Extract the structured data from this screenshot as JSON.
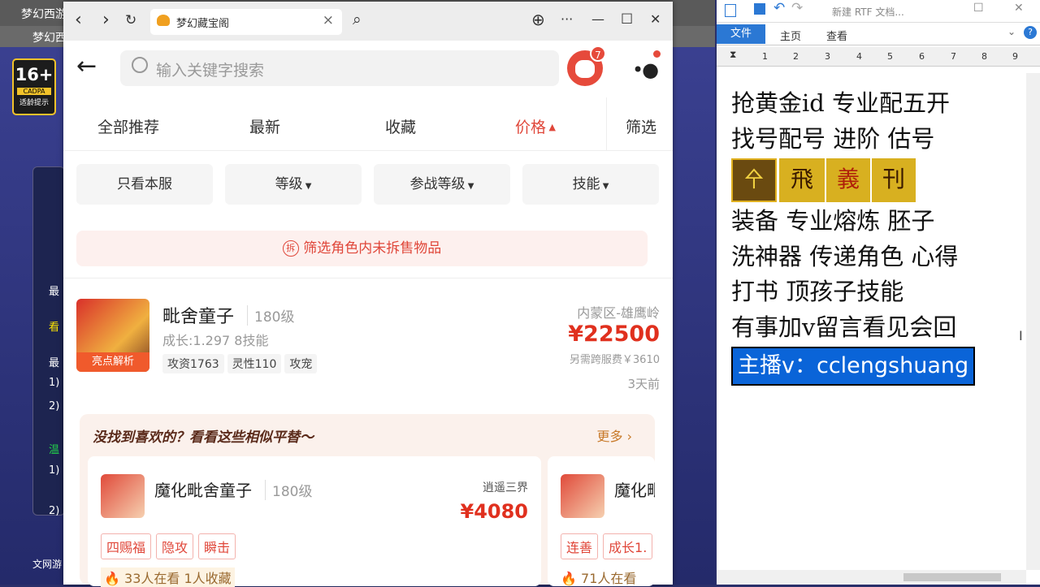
{
  "game": {
    "window_title": "梦幻西游",
    "tab_title": "梦幻西",
    "age_rating": "16+",
    "age_org": "CADPA",
    "age_tip": "适龄提示",
    "side_texts": [
      "最",
      "看",
      "最",
      "1)",
      "2)",
      "温",
      "1)",
      "2)"
    ],
    "footer": "文网游"
  },
  "browser": {
    "tab_title": "梦幻藏宝阁",
    "back": "‹",
    "forward": "›",
    "reload": "↻",
    "close_tab": "×",
    "search_icon": "⌕",
    "globe": "⊕",
    "more": "···",
    "minimize": "—",
    "maximize": "☐",
    "close": "✕"
  },
  "app": {
    "search_placeholder": "输入关键字搜索",
    "msg_badge": "7",
    "sort_tabs": [
      "全部推荐",
      "最新",
      "收藏",
      "价格"
    ],
    "sort_filter": "筛选",
    "sort_active": "价格",
    "filters": [
      "只看本服",
      "等级",
      "参战等级",
      "技能"
    ],
    "notice_icon": "拆",
    "notice": "筛选角色内未拆售物品",
    "item": {
      "name": "毗舍童子",
      "level": "180级",
      "growth": "成长:1.297 8技能",
      "tags": [
        "攻资1763",
        "灵性110",
        "攻宠"
      ],
      "badge": "亮点解析",
      "server": "内蒙区-雄鹰岭",
      "price": "¥22500",
      "fee": "另需跨服费￥3610",
      "time": "3天前"
    },
    "rec": {
      "title": "没找到喜欢的？看看这些相似平替～",
      "more": "更多",
      "cards": [
        {
          "name": "魔化毗舍童子",
          "level": "180级",
          "server": "逍遥三界",
          "price": "¥4080",
          "tags": [
            "四赐福",
            "隐攻",
            "瞬击"
          ],
          "stats": "33人在看  1人收藏"
        },
        {
          "name": "魔化毗",
          "tags": [
            "连善",
            "成长1."
          ],
          "stats": "71人在看"
        }
      ]
    }
  },
  "word": {
    "title": "新建 RTF 文档...",
    "tabs": [
      "文件",
      "主页",
      "查看"
    ],
    "ruler": [
      "1",
      "2",
      "3",
      "4",
      "5",
      "6",
      "7",
      "8",
      "9"
    ],
    "lines": [
      "抢黄金id 专业配五开",
      "找号配号 进阶 估号",
      "装备 专业熔炼 胚子",
      "洗神器 传递角色 心得",
      "打书 顶孩子技能",
      "有事加v留言看见会回"
    ],
    "highlight": "主播v：cclengshuang",
    "icons": [
      "㐃",
      "飛",
      "義",
      "刊"
    ]
  },
  "colors": {
    "price_red": "#e0301e",
    "accent": "#e0473a",
    "word_blue": "#2b78d4",
    "highlight_bg": "#0a64d8"
  }
}
